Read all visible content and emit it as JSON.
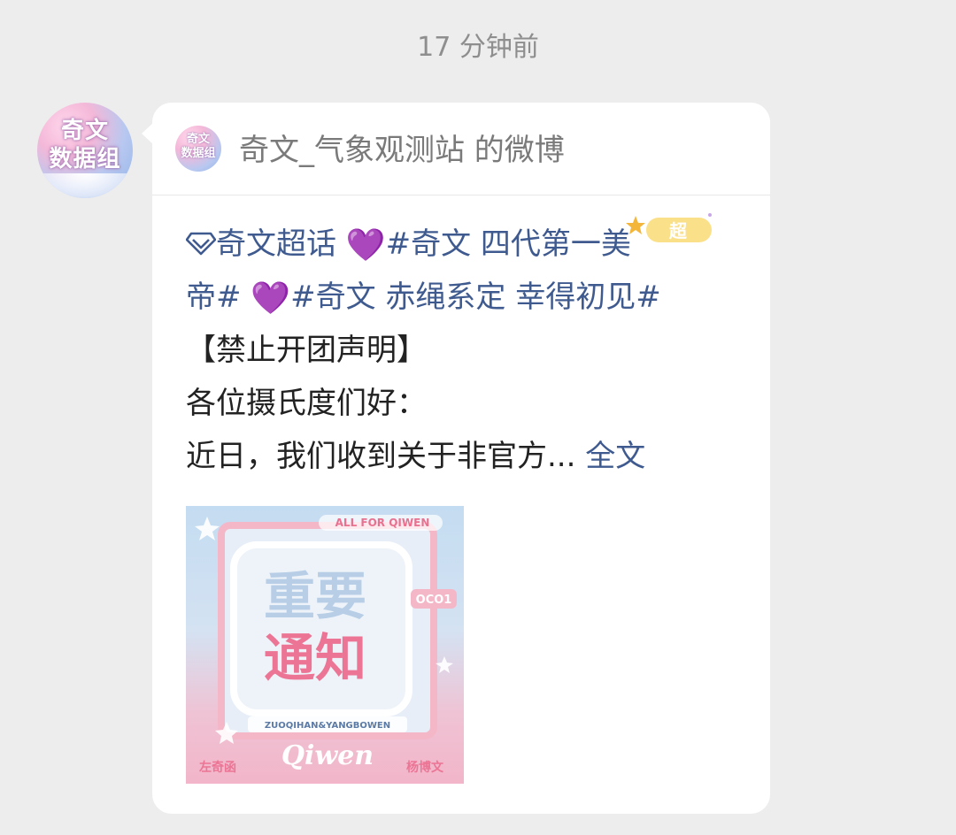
{
  "timestamp": "17 分钟前",
  "sender": {
    "avatar_text_line1": "奇文",
    "avatar_text_line2": "数据组"
  },
  "card": {
    "source_avatar_line1": "奇文",
    "source_avatar_line2": "数据组",
    "source_name": "奇文_气象观测站 的微博",
    "super_badge": "超",
    "post_lines": [
      {
        "supertopic_icon": "diamond-icon",
        "supertopic": "奇文超话",
        "heart1": "💜",
        "tag1_part1": "#奇文 四代第一美"
      },
      {
        "tag1_part2": "帝#",
        "heart2": "💜",
        "tag2": "#奇文 赤绳系定 幸得初见#"
      },
      {
        "text": "【禁止开团声明】"
      },
      {
        "text": "各位摄氏度们好："
      },
      {
        "text": "近日，我们收到关于非官方...",
        "more_link": "全文"
      }
    ],
    "image": {
      "top_label": "ALL FOR QIWEN",
      "title_line1": "重要",
      "title_line2": "通知",
      "side_tag": "OCO1",
      "sub_label": "ZUOQIHAN&YANGBOWEN",
      "script_text": "Qiwen",
      "bottom_left": "左奇函",
      "bottom_right": "杨博文"
    }
  },
  "colors": {
    "background": "#ededed",
    "bubble": "#ffffff",
    "link_blue": "#3f5a8f",
    "heart_purple": "#9b3ee6",
    "timestamp_gray": "#8e8e8e"
  }
}
